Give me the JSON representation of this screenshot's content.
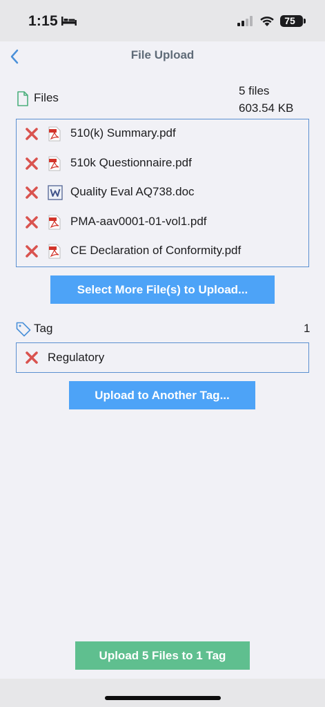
{
  "status_bar": {
    "time": "1:15",
    "battery": "75"
  },
  "nav": {
    "title": "File Upload"
  },
  "files_section": {
    "label": "Files",
    "count": "5 files",
    "size": "603.54 KB",
    "items": [
      {
        "name": "510(k) Summary.pdf",
        "type": "pdf"
      },
      {
        "name": "510k Questionnaire.pdf",
        "type": "pdf"
      },
      {
        "name": "Quality Eval AQ738.doc",
        "type": "doc"
      },
      {
        "name": "PMA-aav0001-01-vol1.pdf",
        "type": "pdf"
      },
      {
        "name": "CE Declaration of Conformity.pdf",
        "type": "pdf"
      }
    ],
    "select_more_label": "Select More File(s) to Upload..."
  },
  "tag_section": {
    "label": "Tag",
    "count": "1",
    "tag_name": "Regulatory",
    "upload_another_label": "Upload to Another Tag..."
  },
  "footer": {
    "upload_label": "Upload 5 Files to 1 Tag"
  },
  "colors": {
    "accent_blue": "#4da3f7",
    "border_blue": "#5a8fd0",
    "remove_red": "#d9534f",
    "upload_green": "#5fbf8f",
    "background": "#f1f1f6"
  },
  "icons": [
    "bed-icon",
    "signal-icon",
    "wifi-icon",
    "back-chevron-icon",
    "file-icon",
    "remove-icon",
    "pdf-icon",
    "word-doc-icon",
    "tag-icon"
  ]
}
